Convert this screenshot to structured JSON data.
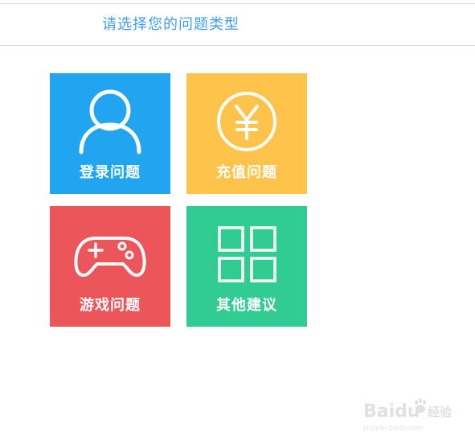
{
  "header": {
    "title": "请选择您的问题类型"
  },
  "tiles": [
    {
      "label": "登录问题",
      "icon": "user-icon",
      "color": "#22a5f1"
    },
    {
      "label": "充值问题",
      "icon": "yen-coin-icon",
      "color": "#fec34a"
    },
    {
      "label": "游戏问题",
      "icon": "gamepad-icon",
      "color": "#ec565b"
    },
    {
      "label": "其他建议",
      "icon": "grid-icon",
      "color": "#30cc94"
    }
  ],
  "watermark": {
    "brand": "Baidu",
    "brand_cn": "经验",
    "url": "jingyan.baidu.com"
  }
}
